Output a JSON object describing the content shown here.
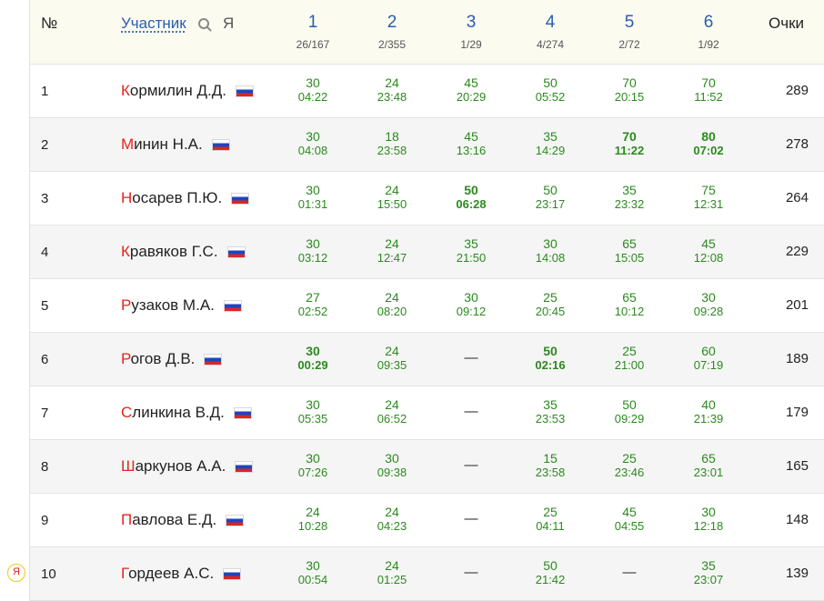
{
  "header": {
    "num_label": "№",
    "participant_label": "Участник",
    "me_label": "Я",
    "score_label": "Очки",
    "tasks": [
      {
        "label": "1",
        "stats": "26/167"
      },
      {
        "label": "2",
        "stats": "2/355"
      },
      {
        "label": "3",
        "stats": "1/29"
      },
      {
        "label": "4",
        "stats": "4/274"
      },
      {
        "label": "5",
        "stats": "2/72"
      },
      {
        "label": "6",
        "stats": "1/92"
      }
    ]
  },
  "colors": {
    "accent": "#2a5db0",
    "result": "#2b8a1e",
    "name_initial": "#e8231c",
    "header_bg": "#fbfbef",
    "row_alt": "#f5f5f5"
  },
  "rows": [
    {
      "rank": "1",
      "initial": "К",
      "rest": "ормилин Д.Д.",
      "score": "289",
      "results": [
        {
          "pts": "30",
          "time": "04:22",
          "best": false
        },
        {
          "pts": "24",
          "time": "23:48",
          "best": false
        },
        {
          "pts": "45",
          "time": "20:29",
          "best": false
        },
        {
          "pts": "50",
          "time": "05:52",
          "best": false
        },
        {
          "pts": "70",
          "time": "20:15",
          "best": false
        },
        {
          "pts": "70",
          "time": "11:52",
          "best": false
        }
      ]
    },
    {
      "rank": "2",
      "initial": "М",
      "rest": "инин Н.А.",
      "score": "278",
      "results": [
        {
          "pts": "30",
          "time": "04:08",
          "best": false
        },
        {
          "pts": "18",
          "time": "23:58",
          "best": false
        },
        {
          "pts": "45",
          "time": "13:16",
          "best": false
        },
        {
          "pts": "35",
          "time": "14:29",
          "best": false
        },
        {
          "pts": "70",
          "time": "11:22",
          "best": true
        },
        {
          "pts": "80",
          "time": "07:02",
          "best": true
        }
      ]
    },
    {
      "rank": "3",
      "initial": "Н",
      "rest": "осарев П.Ю.",
      "score": "264",
      "results": [
        {
          "pts": "30",
          "time": "01:31",
          "best": false
        },
        {
          "pts": "24",
          "time": "15:50",
          "best": false
        },
        {
          "pts": "50",
          "time": "06:28",
          "best": true
        },
        {
          "pts": "50",
          "time": "23:17",
          "best": false
        },
        {
          "pts": "35",
          "time": "23:32",
          "best": false
        },
        {
          "pts": "75",
          "time": "12:31",
          "best": false
        }
      ]
    },
    {
      "rank": "4",
      "initial": "К",
      "rest": "равяков Г.С.",
      "score": "229",
      "results": [
        {
          "pts": "30",
          "time": "03:12",
          "best": false
        },
        {
          "pts": "24",
          "time": "12:47",
          "best": false
        },
        {
          "pts": "35",
          "time": "21:50",
          "best": false
        },
        {
          "pts": "30",
          "time": "14:08",
          "best": false
        },
        {
          "pts": "65",
          "time": "15:05",
          "best": false
        },
        {
          "pts": "45",
          "time": "12:08",
          "best": false
        }
      ]
    },
    {
      "rank": "5",
      "initial": "Р",
      "rest": "узаков М.А.",
      "score": "201",
      "results": [
        {
          "pts": "27",
          "time": "02:52",
          "best": false
        },
        {
          "pts": "24",
          "time": "08:20",
          "best": false
        },
        {
          "pts": "30",
          "time": "09:12",
          "best": false
        },
        {
          "pts": "25",
          "time": "20:45",
          "best": false
        },
        {
          "pts": "65",
          "time": "10:12",
          "best": false
        },
        {
          "pts": "30",
          "time": "09:28",
          "best": false
        }
      ]
    },
    {
      "rank": "6",
      "initial": "Р",
      "rest": "огов Д.В.",
      "score": "189",
      "results": [
        {
          "pts": "30",
          "time": "00:29",
          "best": true
        },
        {
          "pts": "24",
          "time": "09:35",
          "best": false
        },
        null,
        {
          "pts": "50",
          "time": "02:16",
          "best": true
        },
        {
          "pts": "25",
          "time": "21:00",
          "best": false
        },
        {
          "pts": "60",
          "time": "07:19",
          "best": false
        }
      ]
    },
    {
      "rank": "7",
      "initial": "С",
      "rest": "линкина В.Д.",
      "score": "179",
      "results": [
        {
          "pts": "30",
          "time": "05:35",
          "best": false
        },
        {
          "pts": "24",
          "time": "06:52",
          "best": false
        },
        null,
        {
          "pts": "35",
          "time": "23:53",
          "best": false
        },
        {
          "pts": "50",
          "time": "09:29",
          "best": false
        },
        {
          "pts": "40",
          "time": "21:39",
          "best": false
        }
      ]
    },
    {
      "rank": "8",
      "initial": "Ш",
      "rest": "аркунов А.А.",
      "score": "165",
      "results": [
        {
          "pts": "30",
          "time": "07:26",
          "best": false
        },
        {
          "pts": "30",
          "time": "09:38",
          "best": false
        },
        null,
        {
          "pts": "15",
          "time": "23:58",
          "best": false
        },
        {
          "pts": "25",
          "time": "23:46",
          "best": false
        },
        {
          "pts": "65",
          "time": "23:01",
          "best": false
        }
      ]
    },
    {
      "rank": "9",
      "initial": "П",
      "rest": "авлова Е.Д.",
      "score": "148",
      "results": [
        {
          "pts": "24",
          "time": "10:28",
          "best": false
        },
        {
          "pts": "24",
          "time": "04:23",
          "best": false
        },
        null,
        {
          "pts": "25",
          "time": "04:11",
          "best": false
        },
        {
          "pts": "45",
          "time": "04:55",
          "best": false
        },
        {
          "pts": "30",
          "time": "12:18",
          "best": false
        }
      ]
    },
    {
      "rank": "10",
      "initial": "Г",
      "rest": "ордеев А.С.",
      "score": "139",
      "results": [
        {
          "pts": "30",
          "time": "00:54",
          "best": false
        },
        {
          "pts": "24",
          "time": "01:25",
          "best": false
        },
        null,
        {
          "pts": "50",
          "time": "21:42",
          "best": false
        },
        null,
        {
          "pts": "35",
          "time": "23:07",
          "best": false
        }
      ]
    }
  ],
  "dash": "—",
  "me_marker": "Я"
}
